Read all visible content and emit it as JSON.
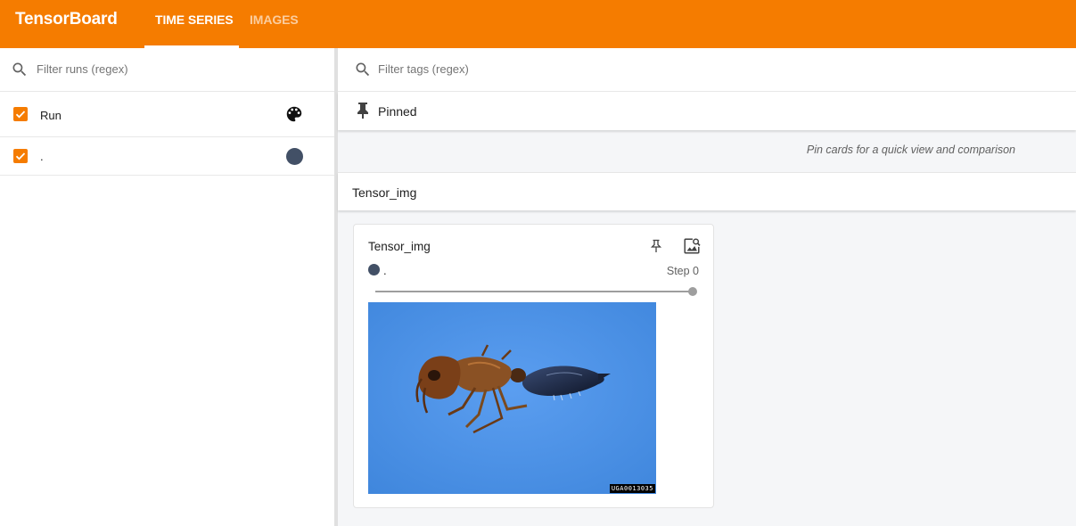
{
  "app": {
    "title": "TensorBoard"
  },
  "tabs": [
    {
      "label": "TIME SERIES",
      "active": true
    },
    {
      "label": "IMAGES",
      "active": false
    }
  ],
  "sidebar": {
    "search": {
      "placeholder": "Filter runs (regex)",
      "icon": "search-icon"
    },
    "runs": [
      {
        "label": "Run",
        "checked": true,
        "icon": "palette-icon"
      },
      {
        "label": ".",
        "checked": true,
        "color": "#425066"
      }
    ]
  },
  "main": {
    "search": {
      "placeholder": "Filter tags (regex)",
      "icon": "search-icon"
    },
    "pinned": {
      "label": "Pinned",
      "hint": "Pin cards for a quick view and comparison"
    },
    "group": {
      "label": "Tensor_img"
    },
    "card": {
      "title": "Tensor_img",
      "run": ".",
      "run_color": "#425066",
      "step": "Step 0",
      "step_slider_fraction": 1.0,
      "image_id": "UGA0013035"
    }
  },
  "colors": {
    "header": "#f57c00",
    "accent": "#f57c00",
    "image_background": "#4a90e2"
  }
}
